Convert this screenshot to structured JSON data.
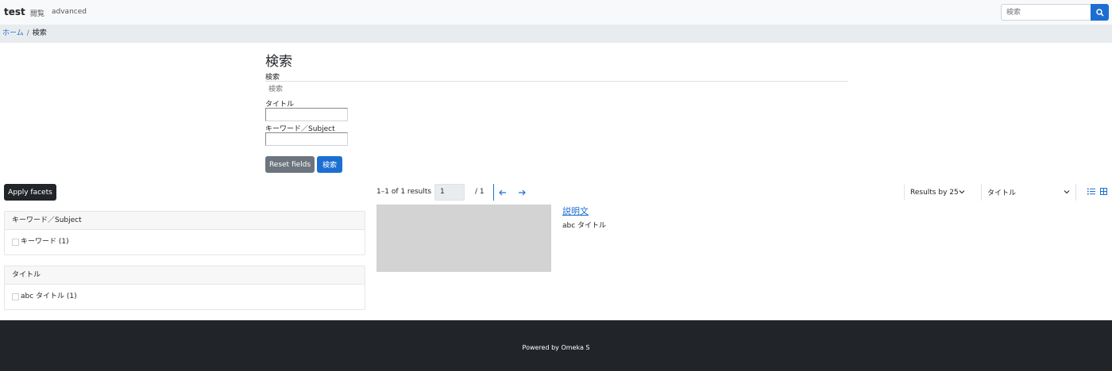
{
  "navbar": {
    "brand": "test",
    "links": [
      "閲覧",
      "advanced"
    ],
    "search_placeholder": "検索"
  },
  "breadcrumb": {
    "home": "ホーム",
    "separator": "/",
    "current": "検索"
  },
  "form": {
    "page_title": "検索",
    "fulltext_label": "検索",
    "fulltext_placeholder": "検索",
    "title_label": "タイトル",
    "keyword_label": "キーワード／Subject",
    "reset_label": "Reset fields",
    "submit_label": "検索"
  },
  "facets": {
    "apply_label": "Apply facets",
    "groups": [
      {
        "heading": "キーワード／Subject",
        "option": "キーワード (1)"
      },
      {
        "heading": "タイトル",
        "option": "abc タイトル (1)"
      }
    ]
  },
  "results": {
    "count_text": "1–1 of 1 results",
    "page_value": "1",
    "page_total": "/ 1",
    "prev_icon": "arrow-left-icon",
    "next_icon": "arrow-right-icon",
    "per_page_label": "Results by 25",
    "sort_label": "タイトル",
    "items": [
      {
        "title": "説明文",
        "description": "abc タイトル"
      }
    ]
  },
  "footer": {
    "text": "Powered by Omeka S"
  },
  "colors": {
    "accent": "#1c6fd1",
    "dark": "#212529",
    "secondary": "#6c757d"
  }
}
